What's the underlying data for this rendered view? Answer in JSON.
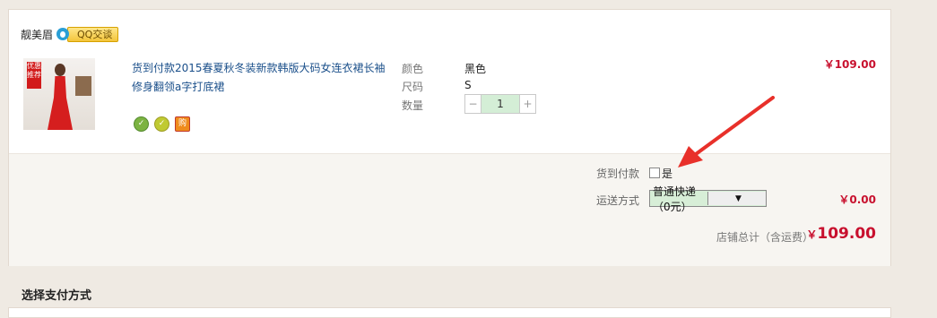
{
  "shop": {
    "name": "靓美眉",
    "qq_button": "QQ交谈"
  },
  "item": {
    "thumb_tag": "优惠推荐",
    "title": "货到付款2015春夏秋冬装新款韩版大码女连衣裙长袖修身翻领a字打底裙",
    "attrs": [
      {
        "label": "颜色",
        "value": "黑色"
      },
      {
        "label": "尺码",
        "value": "S"
      }
    ],
    "qty_label": "数量",
    "qty_minus": "−",
    "qty_value": "1",
    "qty_plus": "+",
    "price": "￥109.00",
    "svc_icons": [
      "shield-icon",
      "badge-icon",
      "purchase-icon"
    ],
    "svc_icon_glyphs": [
      "✓",
      "✓",
      "购"
    ]
  },
  "order": {
    "cod_label": "货到付款",
    "cod_option": "是",
    "ship_label": "运送方式",
    "ship_value": "普通快递（0元）",
    "ship_arrow": "▼",
    "ship_price": "￥0.00",
    "total_label": "店铺总计（含运费）",
    "total_currency": "￥",
    "total_amount": "109.00"
  },
  "payment_section_title": "选择支付方式",
  "colors": {
    "price_red": "#c8102e",
    "link_blue": "#1a4f8a",
    "arrow_red": "#e8302a"
  }
}
